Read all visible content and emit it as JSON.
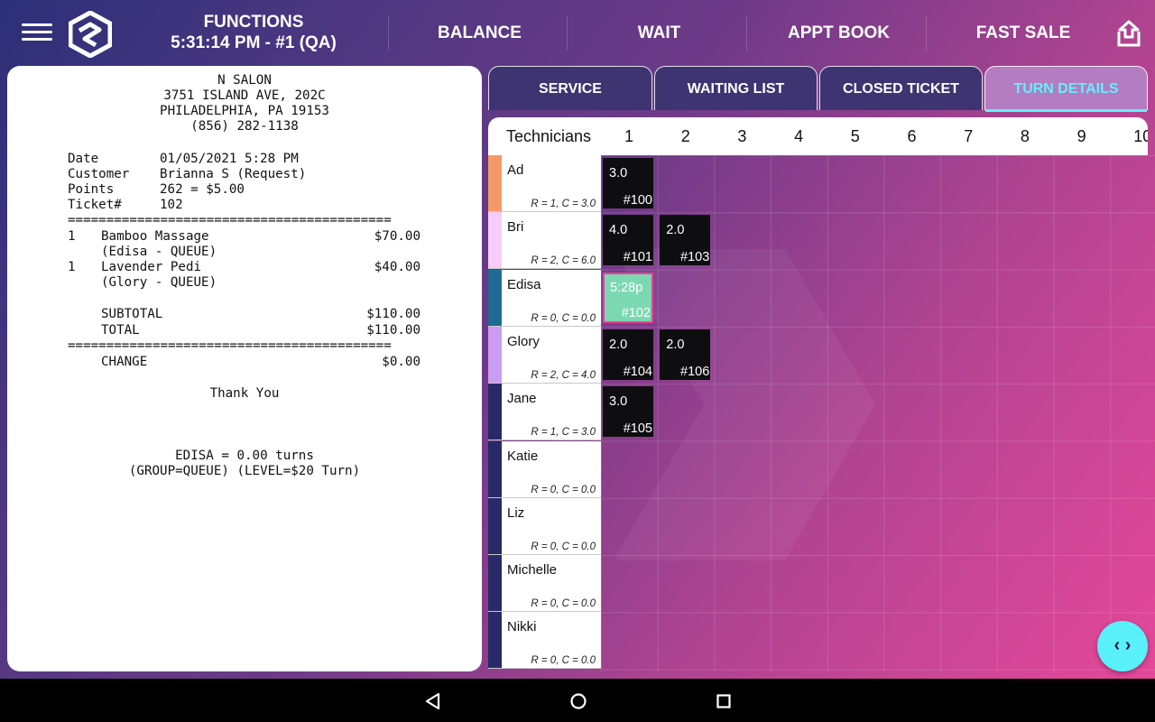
{
  "header": {
    "title": "FUNCTIONS",
    "subtitle": "5:31:14 PM - #1 (QA)",
    "menu_icon": "hamburger-menu-icon",
    "logo_icon": "app-logo-icon",
    "logout_icon": "logout-icon"
  },
  "nav": [
    {
      "label": "BALANCE"
    },
    {
      "label": "WAIT"
    },
    {
      "label": "APPT BOOK"
    },
    {
      "label": "FAST SALE"
    }
  ],
  "receipt": {
    "business_name": "N SALON",
    "address1": "3751 ISLAND AVE, 202C",
    "address2": "PHILADELPHIA, PA 19153",
    "phone": "(856) 282-1138",
    "details": [
      {
        "label": "Date",
        "value": "01/05/2021 5:28 PM"
      },
      {
        "label": "Customer",
        "value": "Brianna S (Request)"
      },
      {
        "label": "Points",
        "value": "262 = $5.00"
      },
      {
        "label": "Ticket#",
        "value": "102"
      }
    ],
    "separator": "==========================================",
    "items": [
      {
        "qty": "1",
        "name": "Bamboo Massage",
        "price": "$70.00",
        "note": "(Edisa - QUEUE)"
      },
      {
        "qty": "1",
        "name": "Lavender Pedi",
        "price": "$40.00",
        "note": "(Glory - QUEUE)"
      }
    ],
    "subtotal_label": "SUBTOTAL",
    "subtotal_value": "$110.00",
    "total_label": "TOTAL",
    "total_value": "$110.00",
    "change_label": "CHANGE",
    "change_value": "$0.00",
    "thank_you": "Thank You",
    "turn_line1": "EDISA = 0.00 turns",
    "turn_line2": "(GROUP=QUEUE) (LEVEL=$20 Turn)"
  },
  "tabs": [
    {
      "label": "SERVICE",
      "active": false
    },
    {
      "label": "WAITING LIST",
      "active": false
    },
    {
      "label": "CLOSED TICKET",
      "active": false
    },
    {
      "label": "TURN DETAILS",
      "active": true
    }
  ],
  "grid": {
    "header_label": "Technicians",
    "columns": [
      "1",
      "2",
      "3",
      "4",
      "5",
      "6",
      "7",
      "8",
      "9",
      "10"
    ]
  },
  "technicians": [
    {
      "name": "Ad",
      "stats": "R = 1, C = 3.0",
      "color": "#f49a68"
    },
    {
      "name": "Bri",
      "stats": "R = 2, C = 6.0",
      "color": "#f8ccf8"
    },
    {
      "name": "Edisa",
      "stats": "R = 0, C = 0.0",
      "color": "#1f6b93"
    },
    {
      "name": "Glory",
      "stats": "R = 2, C = 4.0",
      "color": "#cc9bf3"
    },
    {
      "name": "Jane",
      "stats": "R = 1, C = 3.0",
      "color": "#282a68"
    },
    {
      "name": "Katie",
      "stats": "R = 0, C = 0.0",
      "color": "#282a68"
    },
    {
      "name": "Liz",
      "stats": "R = 0, C = 0.0",
      "color": "#282a68"
    },
    {
      "name": "Michelle",
      "stats": "R = 0, C = 0.0",
      "color": "#282a68"
    },
    {
      "name": "Nikki",
      "stats": "R = 0, C = 0.0",
      "color": "#282a68"
    }
  ],
  "turns": [
    {
      "tech": 0,
      "col": 0,
      "value": "3.0",
      "ticket": "#100",
      "current": false
    },
    {
      "tech": 1,
      "col": 0,
      "value": "4.0",
      "ticket": "#101",
      "current": false
    },
    {
      "tech": 1,
      "col": 1,
      "value": "2.0",
      "ticket": "#103",
      "current": false
    },
    {
      "tech": 2,
      "col": 0,
      "value": "5:28p",
      "ticket": "#102",
      "current": true
    },
    {
      "tech": 3,
      "col": 0,
      "value": "2.0",
      "ticket": "#104",
      "current": false
    },
    {
      "tech": 3,
      "col": 1,
      "value": "2.0",
      "ticket": "#106",
      "current": false
    },
    {
      "tech": 4,
      "col": 0,
      "value": "3.0",
      "ticket": "#105",
      "current": false
    }
  ],
  "fab": {
    "label": "‹ ›",
    "icon": "expand-code-icon"
  },
  "system_nav": {
    "back_icon": "back-icon",
    "home_icon": "home-icon",
    "recents_icon": "recents-icon"
  },
  "colors": {
    "accent": "#62f0ff",
    "active_tab_bg": "#b47cc1",
    "current_ticket": "#7cd8b3",
    "current_ticket_border": "#e64490"
  }
}
